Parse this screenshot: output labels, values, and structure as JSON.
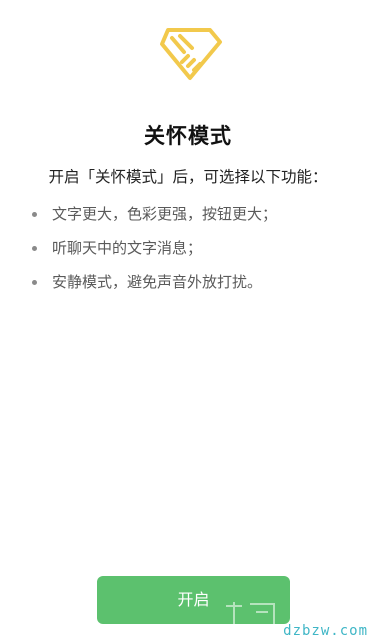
{
  "colors": {
    "accent_yellow": "#f2c94c",
    "button_green": "#5cc16e",
    "title": "#111111",
    "body_text": "#5a5a5a",
    "watermark": "#3fb6c6"
  },
  "icons": {
    "logo": "care-heart-handshake-icon",
    "bullet": "bullet-dot-icon"
  },
  "care_mode": {
    "title": "关怀模式",
    "intro": "开启「关怀模式」后，可选择以下功能：",
    "features": [
      "文字更大，色彩更强，按钮更大；",
      "听聊天中的文字消息；",
      "安静模式，避免声音外放打扰。"
    ],
    "enable_label": "开启"
  },
  "watermark": {
    "text": "dzbzw.com"
  }
}
